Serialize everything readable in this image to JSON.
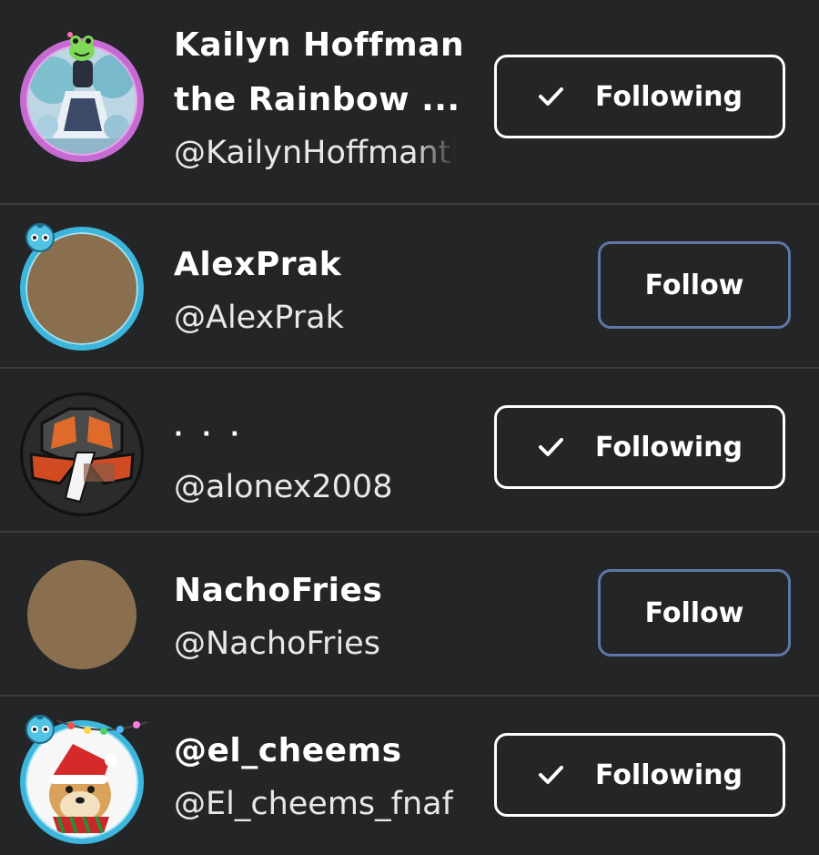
{
  "users": [
    {
      "display_name": "Kailyn Hoffman the Rainbow ...",
      "handle": "@KailynHoffmanth",
      "button": {
        "label": "Following",
        "state": "following"
      }
    },
    {
      "display_name": "AlexPrak",
      "handle": "@AlexPrak",
      "button": {
        "label": "Follow",
        "state": "follow"
      }
    },
    {
      "display_name": "· · ·",
      "handle": "@alonex2008",
      "button": {
        "label": "Following",
        "state": "following"
      }
    },
    {
      "display_name": "NachoFries",
      "handle": "@NachoFries",
      "button": {
        "label": "Follow",
        "state": "follow"
      }
    },
    {
      "display_name": "@el_cheems",
      "handle": "@El_cheems_fnaf",
      "button": {
        "label": "Following",
        "state": "following"
      }
    }
  ],
  "colors": {
    "background": "#232527",
    "divider": "#3a3c3e",
    "following_border": "#ffffff",
    "follow_border": "#5f76a6",
    "placeholder_avatar": "#8a6f4e"
  },
  "icons": {
    "following_check": "checkmark-icon"
  }
}
